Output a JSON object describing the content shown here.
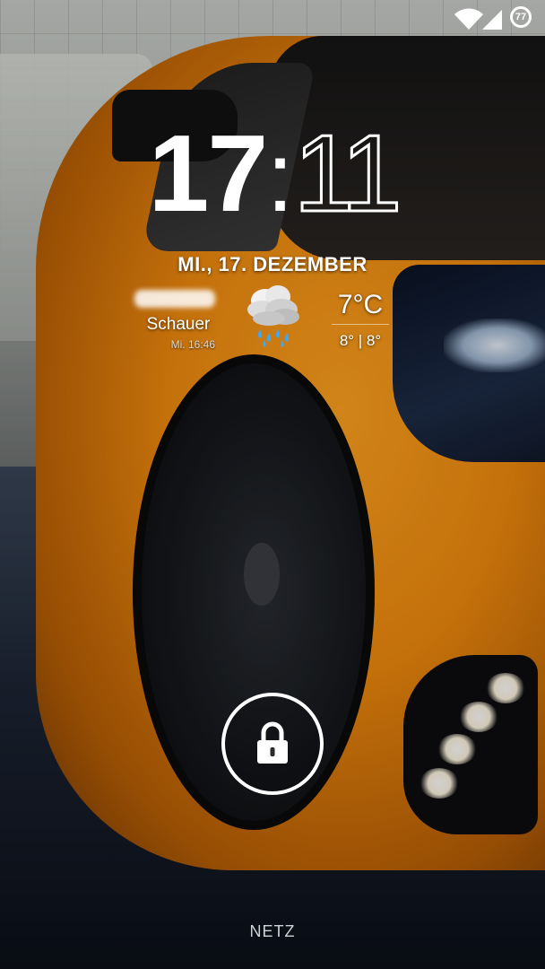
{
  "status_bar": {
    "icons": [
      "wifi-icon",
      "signal-icon",
      "battery-icon"
    ],
    "battery_level": "77"
  },
  "clock": {
    "hours": "17",
    "separator": ":",
    "minutes": "11"
  },
  "date": "MI., 17. DEZEMBER",
  "weather": {
    "condition": "Schauer",
    "updated": "Mi. 16:46",
    "icon": "rain-cloud-icon",
    "temperature": "7°C",
    "range": "8° | 8°"
  },
  "lock": {
    "icon": "lock-icon"
  },
  "carrier": "NETZ",
  "colors": {
    "car_orange": "#f08a0e",
    "text": "#ffffff"
  }
}
